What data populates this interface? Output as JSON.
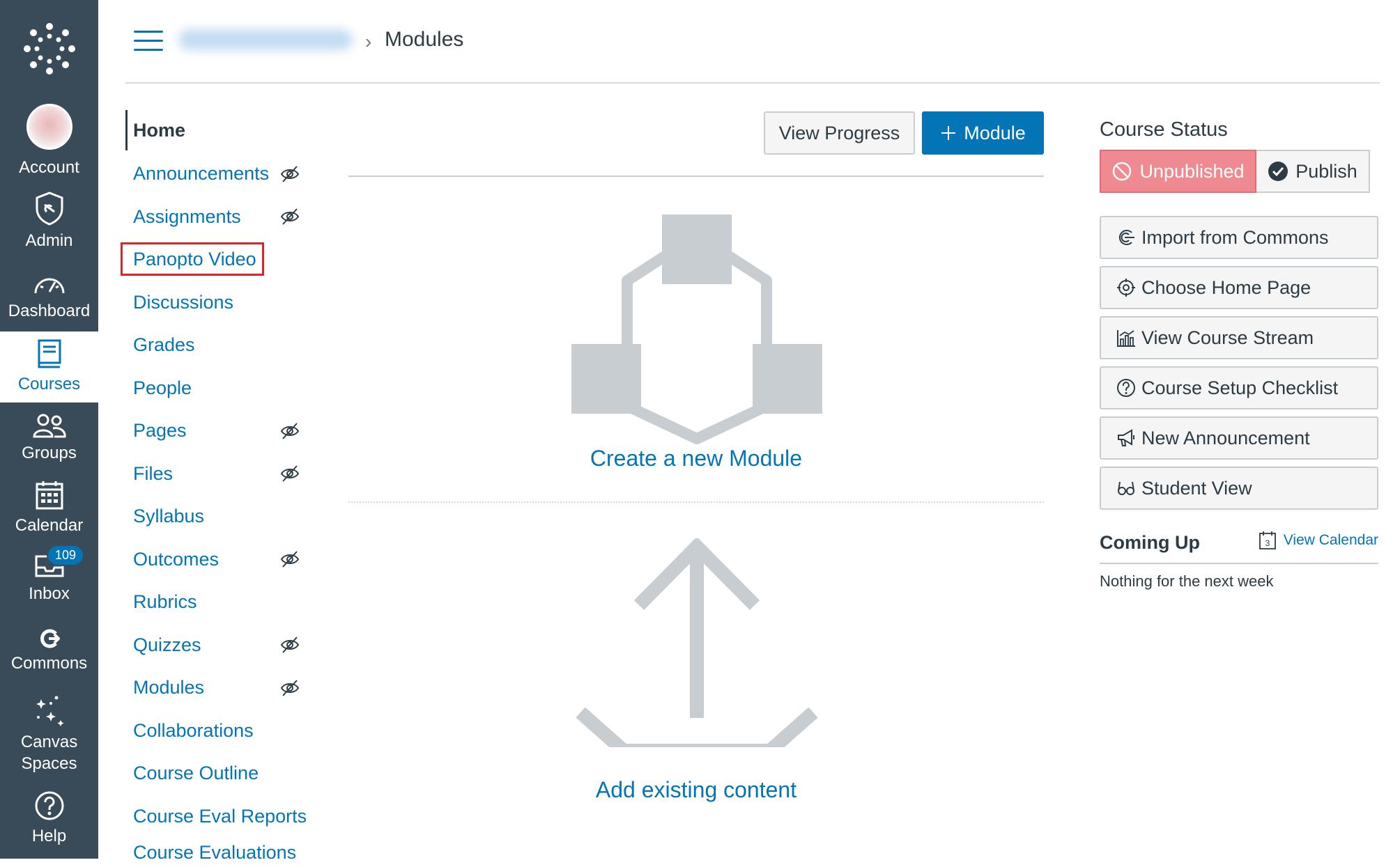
{
  "global_nav": {
    "account": "Account",
    "admin": "Admin",
    "dashboard": "Dashboard",
    "courses": "Courses",
    "groups": "Groups",
    "calendar": "Calendar",
    "inbox": "Inbox",
    "inbox_badge": "109",
    "commons": "Commons",
    "canvas_spaces": "Canvas Spaces",
    "help": "Help"
  },
  "header": {
    "breadcrumb_separator": "›",
    "breadcrumb_current": "Modules"
  },
  "course_nav": {
    "items": [
      {
        "label": "Home",
        "hidden": false
      },
      {
        "label": "Announcements",
        "hidden": true
      },
      {
        "label": "Assignments",
        "hidden": true
      },
      {
        "label": "Panopto Video",
        "hidden": false
      },
      {
        "label": "Discussions",
        "hidden": false
      },
      {
        "label": "Grades",
        "hidden": false
      },
      {
        "label": "People",
        "hidden": false
      },
      {
        "label": "Pages",
        "hidden": true
      },
      {
        "label": "Files",
        "hidden": true
      },
      {
        "label": "Syllabus",
        "hidden": false
      },
      {
        "label": "Outcomes",
        "hidden": true
      },
      {
        "label": "Rubrics",
        "hidden": false
      },
      {
        "label": "Quizzes",
        "hidden": true
      },
      {
        "label": "Modules",
        "hidden": true
      },
      {
        "label": "Collaborations",
        "hidden": false
      },
      {
        "label": "Course Outline",
        "hidden": false
      },
      {
        "label": "Course Eval Reports",
        "hidden": false
      },
      {
        "label": "Course Evaluations",
        "hidden": false
      }
    ]
  },
  "main": {
    "view_progress": "View Progress",
    "add_module": "Module",
    "create_module": "Create a new Module",
    "add_existing": "Add existing content"
  },
  "sidebar": {
    "course_status": "Course Status",
    "unpublished": "Unpublished",
    "publish": "Publish",
    "actions": [
      {
        "label": "Import from Commons",
        "icon": "commons-icon"
      },
      {
        "label": "Choose Home Page",
        "icon": "target-icon"
      },
      {
        "label": "View Course Stream",
        "icon": "stats-icon"
      },
      {
        "label": "Course Setup Checklist",
        "icon": "question-icon"
      },
      {
        "label": "New Announcement",
        "icon": "megaphone-icon"
      },
      {
        "label": "Student View",
        "icon": "glasses-icon"
      }
    ],
    "coming_up": "Coming Up",
    "view_calendar": "View Calendar",
    "calendar_day": "3",
    "nothing": "Nothing for the next week"
  },
  "colors": {
    "nav_bg": "#394b58",
    "brand_blue": "#0374b5",
    "unpublished_red": "#ee8a90",
    "highlight_red": "#d9262c"
  }
}
